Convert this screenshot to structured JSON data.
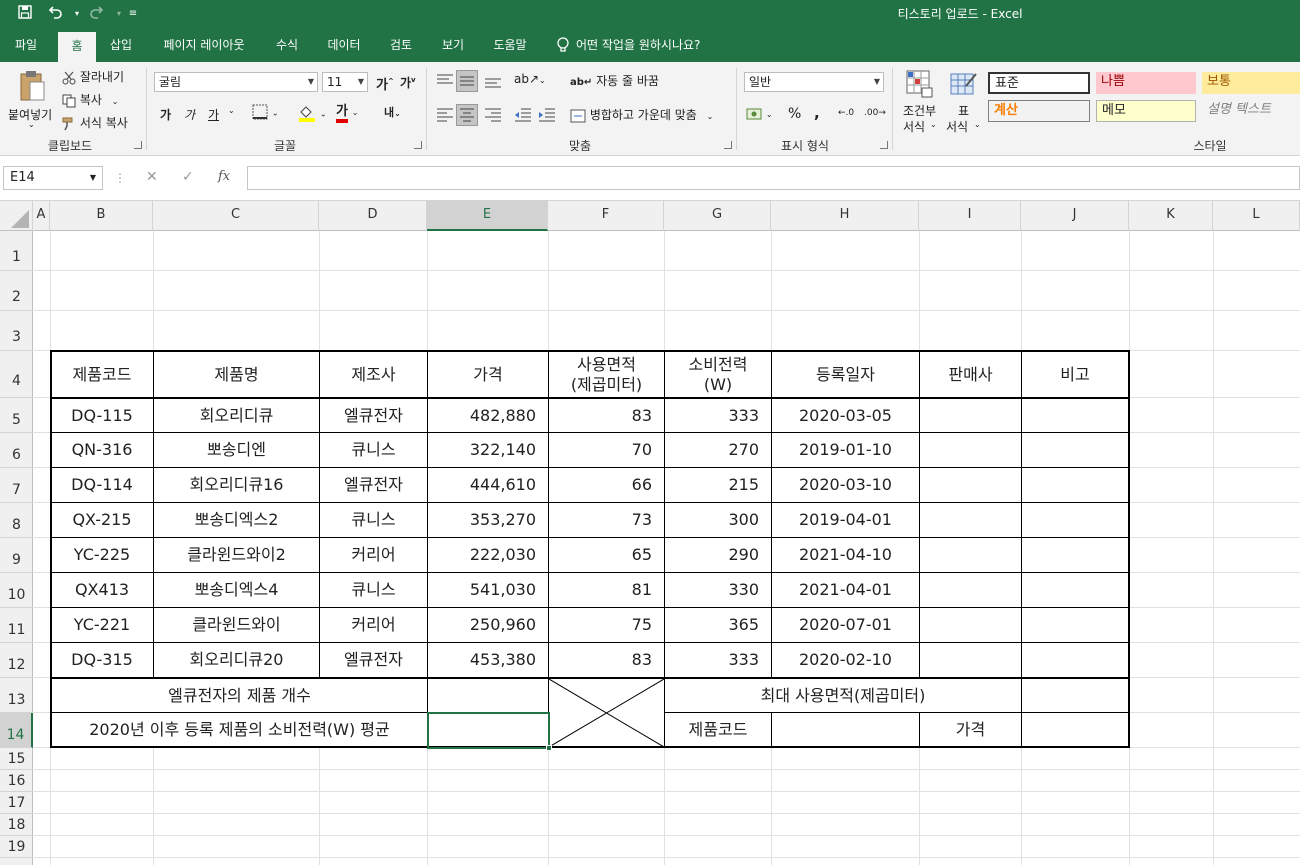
{
  "title": {
    "text": "티스토리 업로드  -  Excel"
  },
  "menu": {
    "tabs": [
      "파일",
      "홈",
      "삽입",
      "페이지 레이아웃",
      "수식",
      "데이터",
      "검토",
      "보기",
      "도움말"
    ],
    "tellme": "어떤 작업을 원하시나요?"
  },
  "ribbon": {
    "clipboard": {
      "label": "클립보드",
      "paste": "붙여넣기",
      "cut": "잘라내기",
      "copy": "복사",
      "format_painter": "서식 복사"
    },
    "font": {
      "label": "글꼴",
      "name": "굴림",
      "size": "11",
      "bold": "가",
      "italic": "가",
      "underline": "가"
    },
    "alignment": {
      "label": "맞춤",
      "wrap": "자동 줄 바꿈",
      "merge": "병합하고 가운데 맞춤"
    },
    "number": {
      "label": "표시 형식",
      "format": "일반",
      "percent": "%",
      "comma": ","
    },
    "styles": {
      "label": "스타일",
      "conditional_1": "조건부",
      "conditional_2": "서식",
      "table_1": "표",
      "table_2": "서식",
      "items": [
        {
          "label": "표준"
        },
        {
          "label": "나쁨"
        },
        {
          "label": "보통"
        },
        {
          "label": "계산"
        },
        {
          "label": "메모"
        },
        {
          "label": "설명 텍스트"
        }
      ]
    }
  },
  "formula_bar": {
    "name_box": "E14",
    "cancel": "✕",
    "enter": "✓",
    "fx": "fx",
    "formula": ""
  },
  "sheet": {
    "columns": [
      "A",
      "B",
      "C",
      "D",
      "E",
      "F",
      "G",
      "H",
      "I",
      "J",
      "K",
      "L"
    ],
    "rows": [
      "1",
      "2",
      "3",
      "4",
      "5",
      "6",
      "7",
      "8",
      "9",
      "10",
      "11",
      "12",
      "13",
      "14",
      "15",
      "16",
      "17",
      "18",
      "19"
    ],
    "selected_cell": "E14",
    "headers": {
      "product_code": "제품코드",
      "product_name": "제품명",
      "maker": "제조사",
      "price": "가격",
      "area_1": "사용면적",
      "area_2": "(제곱미터)",
      "power_1": "소비전력",
      "power_2": "(W)",
      "reg_date": "등록일자",
      "seller": "판매사",
      "note": "비고"
    },
    "data_rows": [
      {
        "code": "DQ-115",
        "name": "회오리디큐",
        "maker": "엘큐전자",
        "price": "482,880",
        "area": "83",
        "power": "333",
        "date": "2020-03-05"
      },
      {
        "code": "QN-316",
        "name": "뽀송디엔",
        "maker": "큐니스",
        "price": "322,140",
        "area": "70",
        "power": "270",
        "date": "2019-01-10"
      },
      {
        "code": "DQ-114",
        "name": "회오리디큐16",
        "maker": "엘큐전자",
        "price": "444,610",
        "area": "66",
        "power": "215",
        "date": "2020-03-10"
      },
      {
        "code": "QX-215",
        "name": "뽀송디엑스2",
        "maker": "큐니스",
        "price": "353,270",
        "area": "73",
        "power": "300",
        "date": "2019-04-01"
      },
      {
        "code": "YC-225",
        "name": "클라윈드와이2",
        "maker": "커리어",
        "price": "222,030",
        "area": "65",
        "power": "290",
        "date": "2021-04-10"
      },
      {
        "code": "QX413",
        "name": "뽀송디엑스4",
        "maker": "큐니스",
        "price": "541,030",
        "area": "81",
        "power": "330",
        "date": "2021-04-01"
      },
      {
        "code": "YC-221",
        "name": "클라윈드와이",
        "maker": "커리어",
        "price": "250,960",
        "area": "75",
        "power": "365",
        "date": "2020-07-01"
      },
      {
        "code": "DQ-315",
        "name": "회오리디큐20",
        "maker": "엘큐전자",
        "price": "453,380",
        "area": "83",
        "power": "333",
        "date": "2020-02-10"
      }
    ],
    "summary": {
      "lq_count": "엘큐전자의 제품 개수",
      "avg_power": "2020년 이후 등록 제품의 소비전력(W) 평균",
      "max_area": "최대 사용면적(제곱미터)",
      "code_label": "제품코드",
      "price_label": "가격"
    }
  }
}
